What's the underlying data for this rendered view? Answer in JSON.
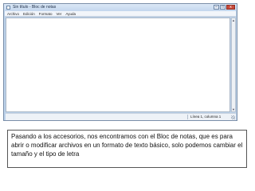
{
  "window": {
    "title": "Sin título - Bloc de notas",
    "controls": {
      "minimize": "–",
      "maximize": "□",
      "close": "x"
    }
  },
  "menubar": {
    "items": [
      "Archivo",
      "Edición",
      "Formato",
      "Ver",
      "Ayuda"
    ]
  },
  "statusbar": {
    "position": "Línea 1, columna 1"
  },
  "scrollbar": {
    "up": "▲",
    "down": "▼"
  },
  "caption": {
    "text": "Pasando a los accesorios, nos encontramos con el Bloc de notas, que es para abrir o modificar archivos en un formato de texto básico, solo podemos cambiar el tamaño y el tipo de letra"
  }
}
